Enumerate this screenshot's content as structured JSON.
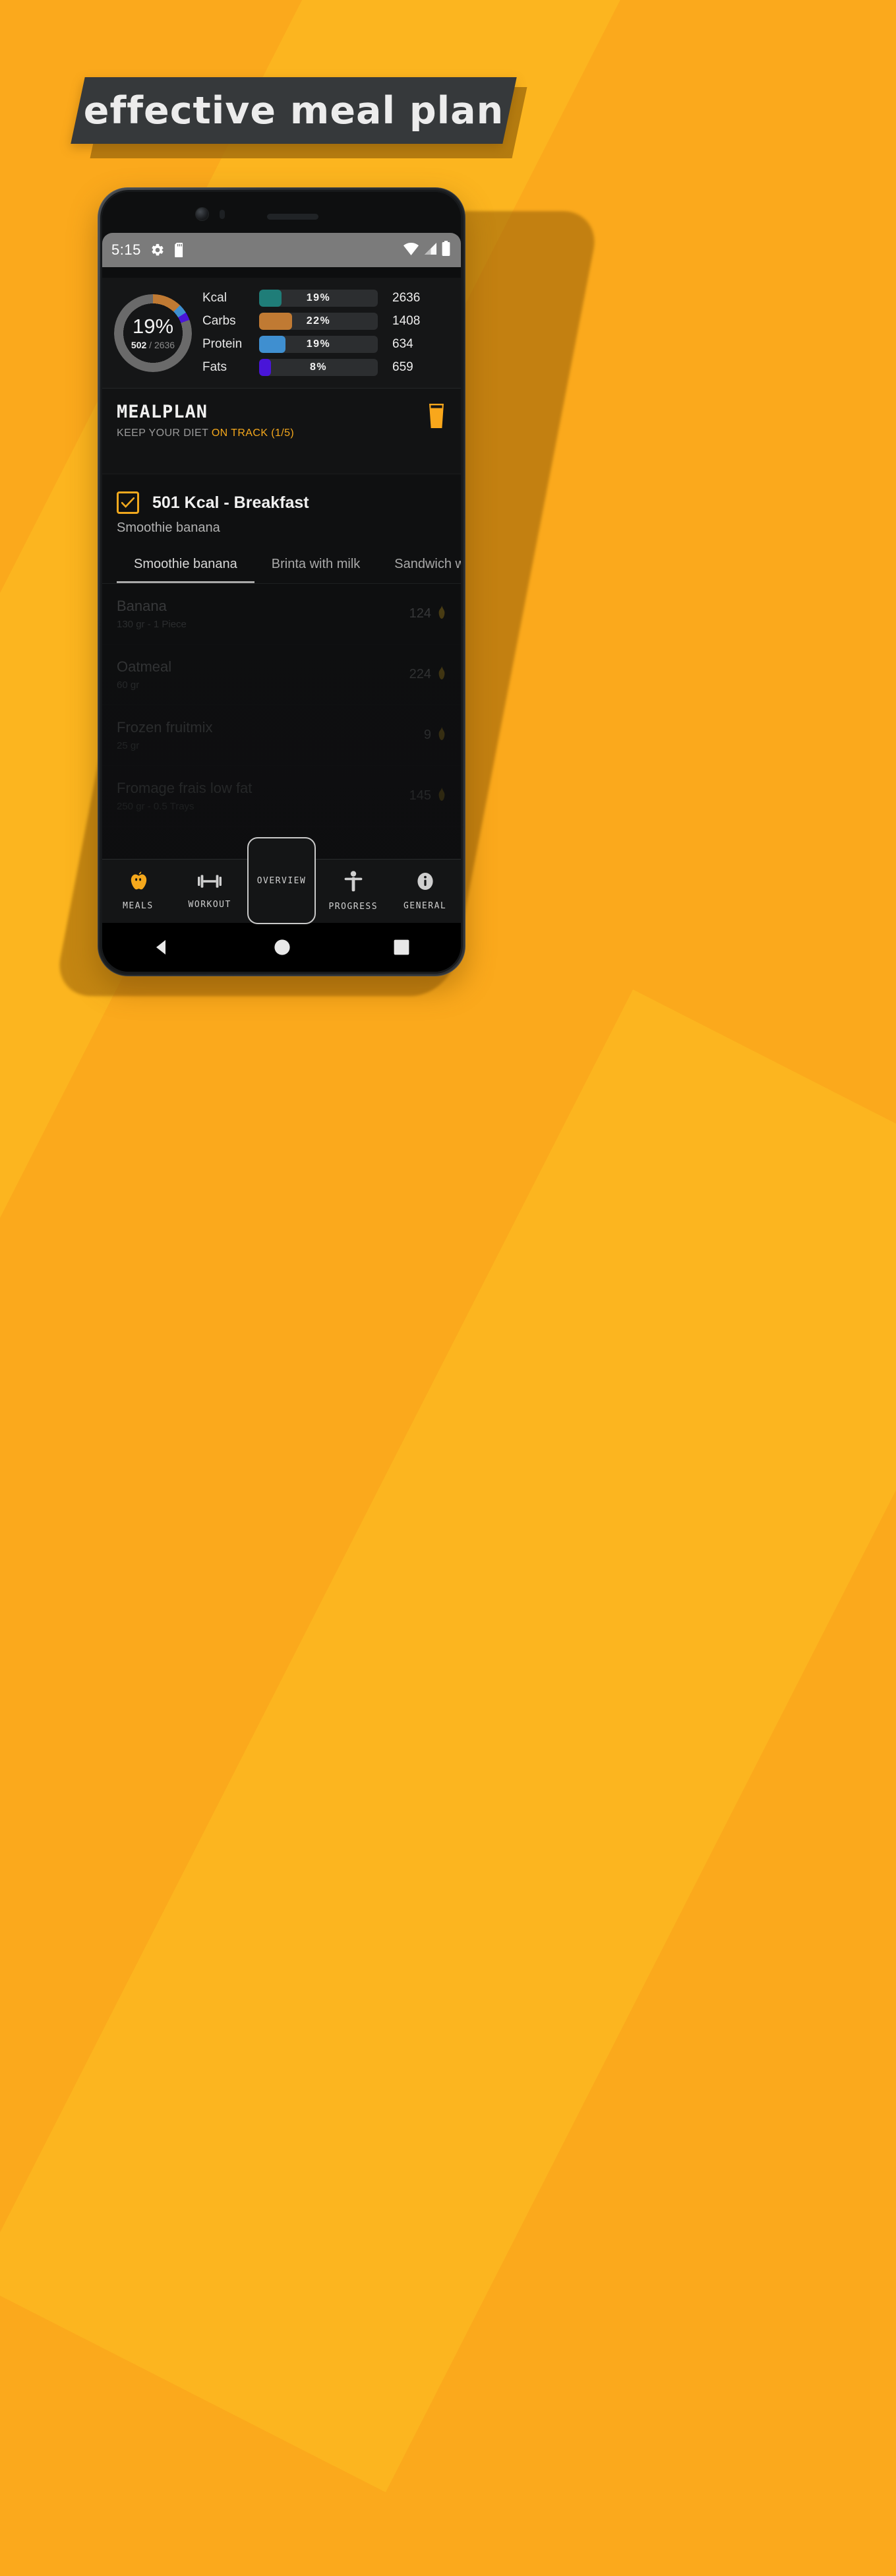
{
  "banner": {
    "text": "effective meal plan"
  },
  "theme": {
    "background": "#FBA91C",
    "banner_bg": "#36393B",
    "accent": "#F5A81C",
    "panel_bg": "#151617",
    "screen_bg": "#0D0E0F"
  },
  "status_bar": {
    "time": "5:15",
    "icons": [
      "gear-icon",
      "sd-card-icon"
    ],
    "right_icons": [
      "wifi-icon",
      "cell-signal-icon",
      "battery-icon"
    ]
  },
  "nutrition": {
    "donut": {
      "percent": "19%",
      "consumed": "502",
      "separator": "/",
      "goal": "2636"
    },
    "macros": [
      {
        "name": "Kcal",
        "percent": "19%",
        "value": "2636",
        "color": "#1F7D78",
        "fill_pct": 19
      },
      {
        "name": "Carbs",
        "percent": "22%",
        "value": "1408",
        "color": "#C07A33",
        "fill_pct": 28
      },
      {
        "name": "Protein",
        "percent": "19%",
        "value": "634",
        "color": "#3F8FD0",
        "fill_pct": 22
      },
      {
        "name": "Fats",
        "percent": "8%",
        "value": "659",
        "color": "#4915D8",
        "fill_pct": 10
      }
    ]
  },
  "mealplan": {
    "title": "MEALPLAN",
    "subtitle_plain": "KEEP YOUR DIET ",
    "subtitle_highlight": "ON TRACK (1/5)",
    "icon": "beer-glass-icon"
  },
  "meal": {
    "checked": true,
    "title": "501 Kcal - Breakfast",
    "subtitle": "Smoothie banana",
    "tabs": [
      {
        "label": "Smoothie banana",
        "active": true
      },
      {
        "label": "Brinta with milk",
        "active": false
      },
      {
        "label": "Sandwich w",
        "active": false
      }
    ],
    "foods": [
      {
        "name": "Banana",
        "qty": "130 gr - 1 Piece",
        "kcal": "124"
      },
      {
        "name": "Oatmeal",
        "qty": "60 gr",
        "kcal": "224"
      },
      {
        "name": "Frozen fruitmix",
        "qty": "25 gr",
        "kcal": "9"
      },
      {
        "name": "Fromage frais low fat",
        "qty": "250 gr - 0.5 Trays",
        "kcal": "145"
      }
    ]
  },
  "bottom_nav": {
    "items": [
      {
        "label": "MEALS",
        "icon": "apple-icon",
        "active": true
      },
      {
        "label": "WORKOUT",
        "icon": "dumbbell-icon",
        "active": false
      },
      {
        "label": "OVERVIEW",
        "icon": "none",
        "active": false
      },
      {
        "label": "PROGRESS",
        "icon": "body-icon",
        "active": false
      },
      {
        "label": "GENERAL",
        "icon": "info-icon",
        "active": false
      }
    ]
  },
  "android_nav": {
    "buttons": [
      "back-triangle-icon",
      "home-circle-icon",
      "recents-square-icon"
    ]
  }
}
